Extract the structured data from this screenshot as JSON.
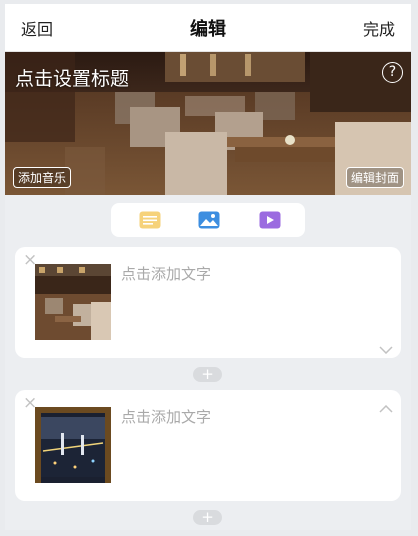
{
  "nav": {
    "back_label": "返回",
    "title": "编辑",
    "done_label": "完成"
  },
  "cover": {
    "title_placeholder": "点击设置标题",
    "help_icon": "?",
    "add_music_label": "添加音乐",
    "edit_cover_label": "编辑封面"
  },
  "toolbar": {
    "items": [
      {
        "icon": "text-icon",
        "color": "#f4c65a"
      },
      {
        "icon": "image-icon",
        "color": "#3d8ee0"
      },
      {
        "icon": "video-icon",
        "color": "#9b6be0"
      }
    ]
  },
  "sections": [
    {
      "text_placeholder": "点击添加文字",
      "close_symbol": "×",
      "chevron": "chevron-down-icon"
    },
    {
      "text_placeholder": "点击添加文字",
      "close_symbol": "×",
      "chevron": "chevron-up-icon"
    }
  ],
  "add_symbol": "+"
}
